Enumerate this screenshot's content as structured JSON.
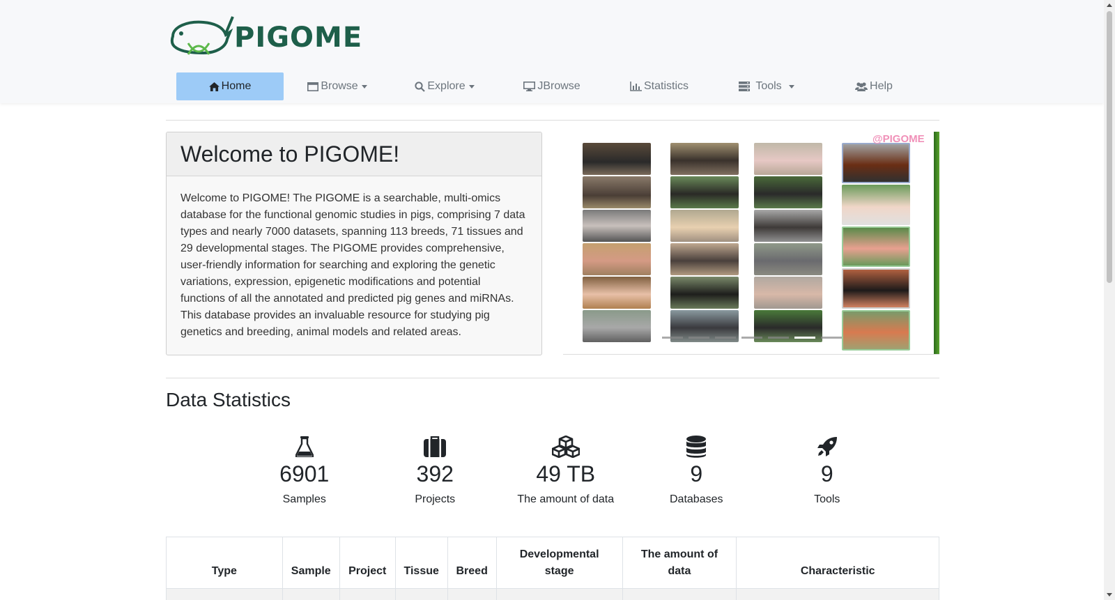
{
  "brand": {
    "name": "PIGOME"
  },
  "nav": {
    "items": [
      {
        "label": "Home",
        "icon": "home-icon",
        "active": true,
        "dropdown": false
      },
      {
        "label": "Browse",
        "icon": "window-icon",
        "active": false,
        "dropdown": true
      },
      {
        "label": "Explore",
        "icon": "search-icon",
        "active": false,
        "dropdown": true
      },
      {
        "label": "JBrowse",
        "icon": "desktop-icon",
        "active": false,
        "dropdown": false
      },
      {
        "label": "Statistics",
        "icon": "bar-chart-icon",
        "active": false,
        "dropdown": false
      },
      {
        "label": "Tools",
        "icon": "server-icon",
        "active": false,
        "dropdown": true
      },
      {
        "label": "Help",
        "icon": "users-icon",
        "active": false,
        "dropdown": false
      }
    ]
  },
  "welcome": {
    "title": "Welcome to PIGOME!",
    "body": "Welcome to PIGOME! The PIGOME is a searchable, multi-omics database for the functional genomic studies in pigs, comprising 7 data types and nearly 7000 datasets, spanning 113 breeds, 71 tissues and 29 developmental stages. The PIGOME provides comprehensive, user-friendly information for searching and exploring the genetic variations, expression, epigenetic modifications and potential functions of all the annotated and predicted pig genes and miRNAs. This database provides an invaluable resource for studying pig genetics and breeding, animal models and related areas."
  },
  "carousel": {
    "watermark": "@PIGOME",
    "slide_count": 7
  },
  "stats_section": {
    "title": "Data Statistics",
    "items": [
      {
        "icon": "flask-icon",
        "value": "6901",
        "label": "Samples"
      },
      {
        "icon": "briefcase-icon",
        "value": "392",
        "label": "Projects"
      },
      {
        "icon": "cubes-icon",
        "value": "49 TB",
        "label": "The amount of data"
      },
      {
        "icon": "database-icon",
        "value": "9",
        "label": "Databases"
      },
      {
        "icon": "rocket-icon",
        "value": "9",
        "label": "Tools"
      }
    ]
  },
  "table": {
    "headers": [
      "Type",
      "Sample",
      "Project",
      "Tissue",
      "Breed",
      "Developmental stage",
      "The amount of data",
      "Characteristic"
    ]
  },
  "colors": {
    "active_nav": "#9dcbf7",
    "brand_green": "#1e5f4a",
    "watermark_pink": "#f090b8"
  }
}
